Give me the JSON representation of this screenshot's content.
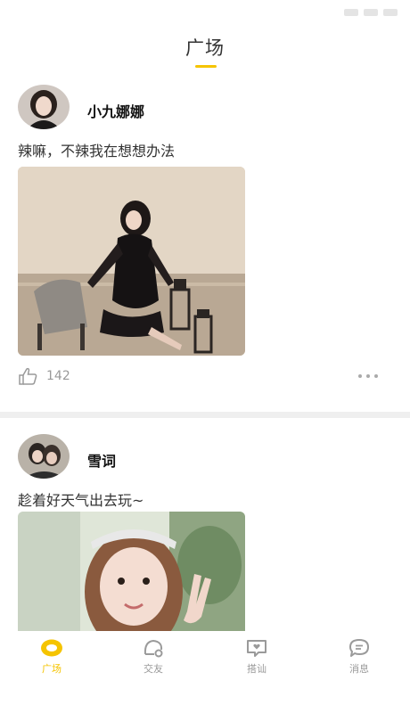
{
  "header": {
    "title": "广场"
  },
  "posts": [
    {
      "username": "小九娜娜",
      "caption": "辣嘛，不辣我在想想办法",
      "likes": "142",
      "avatar_icon": "woman-portrait-avatar",
      "photo_desc": "woman-in-black-lace-dress-photo"
    },
    {
      "username": "雪词",
      "caption": "趁着好天气出去玩~",
      "avatar_icon": "couple-avatar",
      "photo_desc": "girl-peace-sign-photo"
    }
  ],
  "tabs": [
    {
      "label": "广场",
      "icon": "square-icon",
      "active": true
    },
    {
      "label": "交友",
      "icon": "friends-icon",
      "active": false
    },
    {
      "label": "搭讪",
      "icon": "chat-heart-icon",
      "active": false
    },
    {
      "label": "消息",
      "icon": "message-icon",
      "active": false
    }
  ],
  "colors": {
    "accent": "#f5c400",
    "divider": "#efefef",
    "muted": "#999999"
  }
}
